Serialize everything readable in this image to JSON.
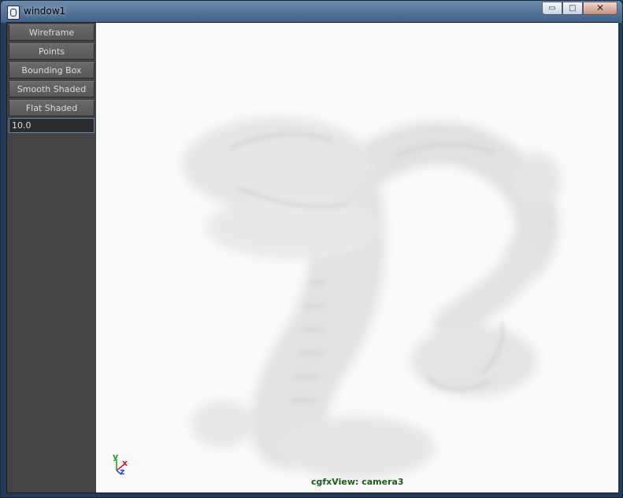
{
  "window": {
    "title": "window1",
    "controls": {
      "minimize": "▭",
      "maximize": "□",
      "close": "✕"
    }
  },
  "sidebar": {
    "buttons": [
      {
        "label": "Wireframe"
      },
      {
        "label": "Points"
      },
      {
        "label": "Bounding Box"
      },
      {
        "label": "Smooth Shaded"
      },
      {
        "label": "Flat Shaded"
      }
    ],
    "field_value": "10.0"
  },
  "viewport": {
    "camera_label": "cgfxView: camera3",
    "axis": {
      "y": "y",
      "x": "x",
      "z": "z"
    },
    "subject": "dragon-model"
  }
}
